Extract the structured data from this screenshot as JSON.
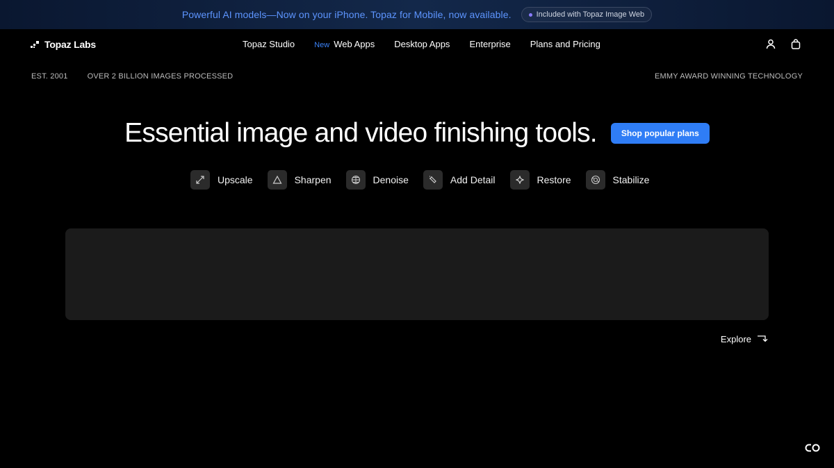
{
  "announcement": {
    "text": "Powerful AI models—Now on your iPhone. Topaz for Mobile, now available.",
    "pill": "Included with Topaz Image Web"
  },
  "nav": {
    "logo": "Topaz Labs",
    "links": [
      {
        "label": "Topaz Studio"
      },
      {
        "badge": "New",
        "label": "Web Apps"
      },
      {
        "label": "Desktop Apps"
      },
      {
        "label": "Enterprise"
      },
      {
        "label": "Plans and Pricing"
      }
    ],
    "icons": [
      "account-icon",
      "cart-icon"
    ]
  },
  "stats": {
    "established": "EST. 2001",
    "processed": "OVER 2 BILLION IMAGES PROCESSED",
    "award": "EMMY AWARD WINNING TECHNOLOGY"
  },
  "hero": {
    "title": "Essential image and video finishing tools.",
    "cta": "Shop popular plans"
  },
  "tools": [
    {
      "label": "Upscale",
      "icon": "upscale-icon"
    },
    {
      "label": "Sharpen",
      "icon": "sharpen-icon"
    },
    {
      "label": "Denoise",
      "icon": "denoise-icon"
    },
    {
      "label": "Add Detail",
      "icon": "add-detail-icon"
    },
    {
      "label": "Restore",
      "icon": "restore-icon"
    },
    {
      "label": "Stabilize",
      "icon": "stabilize-icon"
    }
  ],
  "explore": "Explore",
  "colors": {
    "accent": "#2f7df6",
    "announcement_text": "#5d95ff",
    "background": "#000000",
    "panel": "#1b1b1b"
  }
}
